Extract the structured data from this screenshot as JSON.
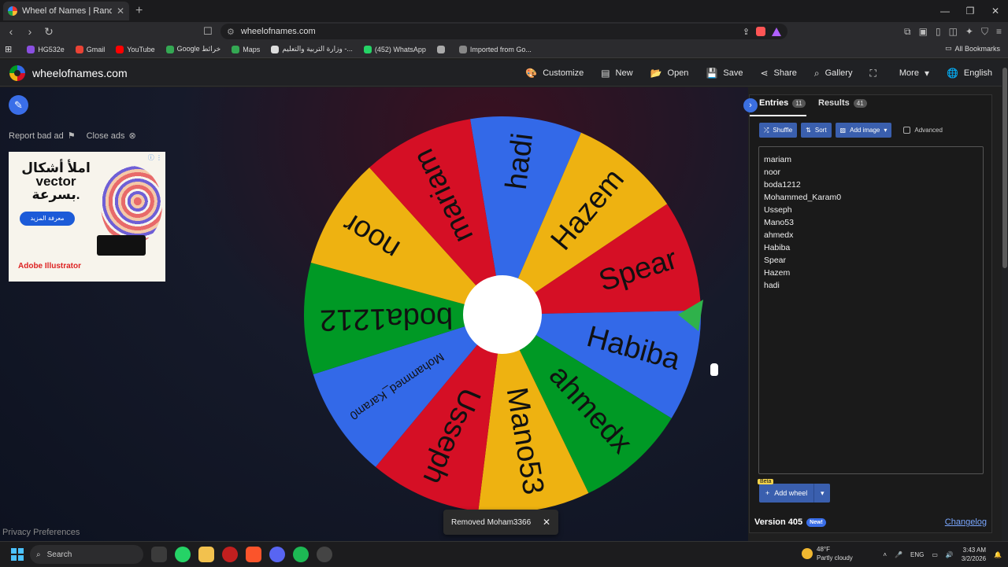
{
  "browser": {
    "tab_title": "Wheel of Names | Random na",
    "new_tab": "+",
    "url": "wheelofnames.com",
    "bookmarks": [
      {
        "label": "HG532e",
        "color": "#8a4fe0"
      },
      {
        "label": "Gmail",
        "color": "#ea4335"
      },
      {
        "label": "YouTube",
        "color": "#ff0000"
      },
      {
        "label": "Google خرائط",
        "color": "#34a853"
      },
      {
        "label": "Maps",
        "color": "#34a853"
      },
      {
        "label": "وزارة التربية والتعليم -...",
        "color": "#dddddd"
      },
      {
        "label": "(452) WhatsApp",
        "color": "#25d366"
      },
      {
        "label": "",
        "color": "#aaaaaa"
      },
      {
        "label": "Imported from Go...",
        "color": "#888888"
      }
    ],
    "all_bookmarks": "All Bookmarks"
  },
  "app": {
    "brand": "wheelofnames.com",
    "menu": [
      {
        "label": "Customize",
        "icon": "palette-icon",
        "glyph": "🎨"
      },
      {
        "label": "New",
        "icon": "file-icon",
        "glyph": "▤"
      },
      {
        "label": "Open",
        "icon": "folder-icon",
        "glyph": "📂"
      },
      {
        "label": "Save",
        "icon": "save-icon",
        "glyph": "💾"
      },
      {
        "label": "Share",
        "icon": "share-icon",
        "glyph": "⋖"
      },
      {
        "label": "Gallery",
        "icon": "search-icon",
        "glyph": "⌕"
      },
      {
        "label": "",
        "icon": "fullscreen-icon",
        "glyph": "⛶"
      },
      {
        "label": "More",
        "icon": "chevron-down-icon",
        "glyph": "▾"
      },
      {
        "label": "English",
        "icon": "globe-icon",
        "glyph": "🌐"
      }
    ]
  },
  "ads": {
    "report": "Report bad ad",
    "close": "Close ads",
    "headline": "املأ أشكال vector بسرعة.",
    "cta": "معرفة المزيد",
    "advertiser": "Adobe Illustrator"
  },
  "privacy": "Privacy Preferences",
  "wheel": {
    "colors": [
      "#3369e8",
      "#eeb211",
      "#d50f25",
      "#3369e8",
      "#009925",
      "#eeb211",
      "#d50f25",
      "#3369e8",
      "#009925",
      "#eeb211",
      "#d50f25"
    ],
    "segments": [
      "hadi",
      "Hazem",
      "Spear",
      "Habiba",
      "ahmedx",
      "Mano53",
      "Usseph",
      "Mohammed_Karam0",
      "boda1212",
      "noor",
      "mariam"
    ]
  },
  "toast": {
    "message": "Removed Moham3366",
    "close": "✕"
  },
  "panel": {
    "entries_label": "Entries",
    "entries_count": "11",
    "results_label": "Results",
    "results_count": "41",
    "shuffle": "Shuffle",
    "sort": "Sort",
    "add_image": "Add image",
    "advanced": "Advanced",
    "entries": [
      "mariam",
      "noor",
      "boda1212",
      "Mohammed_Karam0",
      "Usseph",
      "Mano53",
      "ahmedx",
      "Habiba",
      "Spear",
      "Hazem",
      "hadi"
    ],
    "beta": "Beta",
    "add_wheel": "Add wheel",
    "version": "Version 405",
    "new_badge": "New!",
    "changelog": "Changelog"
  },
  "taskbar": {
    "search": "Search",
    "weather_temp": "48°F",
    "weather_desc": "Partly cloudy",
    "lang": "ENG",
    "time": "3:43 AM",
    "date": "3/2/2026"
  }
}
